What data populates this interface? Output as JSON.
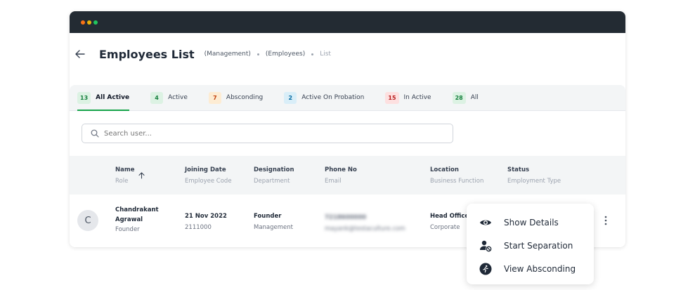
{
  "window": {
    "dots": [
      "#f97316",
      "#eab308",
      "#22c55e"
    ]
  },
  "header": {
    "back_icon": "arrow-left-icon",
    "title": "Employees List",
    "breadcrumbs": [
      "(Management)",
      "(Employees)",
      "List"
    ]
  },
  "tabs": [
    {
      "count": "13",
      "label": "All Active",
      "badge_bg": "#dcf2e3",
      "badge_fg": "#15803d",
      "active": true
    },
    {
      "count": "4",
      "label": "Active",
      "badge_bg": "#dcf2e3",
      "badge_fg": "#15803d",
      "active": false
    },
    {
      "count": "7",
      "label": "Absconding",
      "badge_bg": "#fdecd3",
      "badge_fg": "#c2410c",
      "active": false
    },
    {
      "count": "2",
      "label": "Active On Probation",
      "badge_bg": "#d9eef8",
      "badge_fg": "#0369a1",
      "active": false
    },
    {
      "count": "15",
      "label": "In Active",
      "badge_bg": "#fde0e0",
      "badge_fg": "#b91c1c",
      "active": false
    },
    {
      "count": "28",
      "label": "All",
      "badge_bg": "#dcf2e3",
      "badge_fg": "#15803d",
      "active": false
    }
  ],
  "search": {
    "placeholder": "Search user..."
  },
  "table": {
    "columns": [
      {
        "primary": "Name",
        "secondary": "Role"
      },
      {
        "primary": "Joining Date",
        "secondary": "Employee Code"
      },
      {
        "primary": "Designation",
        "secondary": "Department"
      },
      {
        "primary": "Phone No",
        "secondary": "Email"
      },
      {
        "primary": "Location",
        "secondary": "Business Function"
      },
      {
        "primary": "Status",
        "secondary": "Employment Type"
      }
    ],
    "rows": [
      {
        "avatar": "C",
        "name_line1": "Chandrakant",
        "name_line2": "Agrawal",
        "role": "Founder",
        "joining_date": "21 Nov 2022",
        "employee_code": "2111000",
        "designation": "Founder",
        "department": "Management",
        "phone": "7218600000",
        "email": "mayank@testaculture.com",
        "location": "Head Office",
        "business_function": "Corporate"
      }
    ]
  },
  "menu": [
    {
      "label": "Show Details",
      "icon": "eye-icon"
    },
    {
      "label": "Start Separation",
      "icon": "user-block-icon"
    },
    {
      "label": "View Absconding",
      "icon": "running-person-icon"
    }
  ]
}
